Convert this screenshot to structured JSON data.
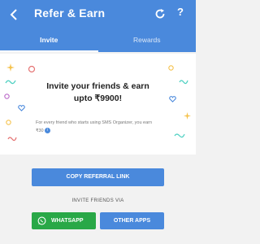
{
  "header": {
    "title": "Refer & Earn",
    "help_label": "?"
  },
  "tabs": [
    {
      "label": "Invite",
      "active": true
    },
    {
      "label": "Rewards",
      "active": false
    }
  ],
  "promo": {
    "headline_line1": "Invite your friends & earn",
    "headline_line2": "upto ₹9900!",
    "description": "For every friend who starts using SMS Organizer, you earn",
    "amount": "₹30",
    "info_icon": "i"
  },
  "actions": {
    "copy_label": "COPY REFERRAL LINK",
    "invite_via_label": "INVITE FRIENDS VIA",
    "whatsapp_label": "WHATSAPP",
    "other_apps_label": "OTHER APPS"
  },
  "colors": {
    "primary": "#4a89dc",
    "whatsapp": "#29a847",
    "background": "#f2f2f2"
  }
}
